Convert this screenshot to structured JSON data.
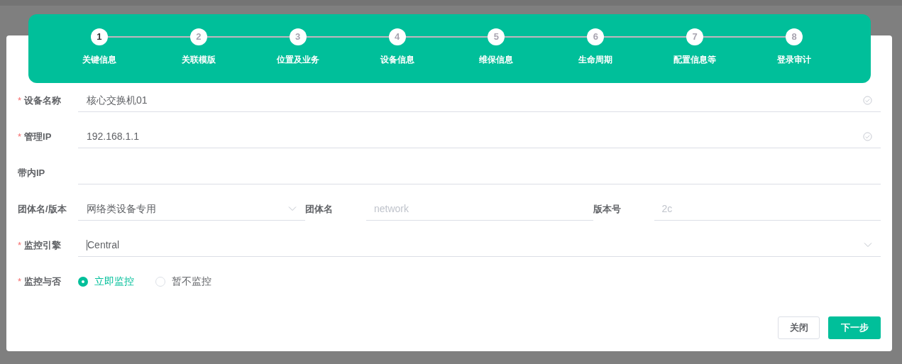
{
  "steps": [
    {
      "number": "1",
      "label": "关键信息",
      "selected": true
    },
    {
      "number": "2",
      "label": "关联模版",
      "selected": false
    },
    {
      "number": "3",
      "label": "位置及业务",
      "selected": false
    },
    {
      "number": "4",
      "label": "设备信息",
      "selected": false
    },
    {
      "number": "5",
      "label": "维保信息",
      "selected": false
    },
    {
      "number": "6",
      "label": "生命周期",
      "selected": false
    },
    {
      "number": "7",
      "label": "配置信息等",
      "selected": false
    },
    {
      "number": "8",
      "label": "登录审计",
      "selected": false
    }
  ],
  "form": [
    {
      "kind": "input",
      "required_mark": "*",
      "label": "设备名称",
      "value": "核心交换机01",
      "valid": true
    },
    {
      "kind": "input",
      "required_mark": "*",
      "label": "管理IP",
      "value": "192.168.1.1",
      "valid": true
    },
    {
      "kind": "input",
      "label": "带内IP"
    },
    {
      "kind": "group",
      "label": "团体名/版本",
      "value": "网络类设备专用",
      "subfields": [
        {
          "label": "团体名",
          "placeholder": "network"
        },
        {
          "label": "版本号",
          "placeholder": "2c"
        }
      ]
    },
    {
      "kind": "select",
      "required_mark": "*",
      "label": "监控引擎",
      "value": "Central",
      "focused": true
    },
    {
      "kind": "radio",
      "required_mark": "*",
      "label": "监控与否",
      "options": [
        {
          "label": "立即监控",
          "selected": true
        },
        {
          "label": "暂不监控",
          "selected": false
        }
      ]
    }
  ],
  "buttons": [
    {
      "label": "关闭",
      "kind": "secondary"
    },
    {
      "label": "下一步",
      "kind": "primary"
    }
  ]
}
